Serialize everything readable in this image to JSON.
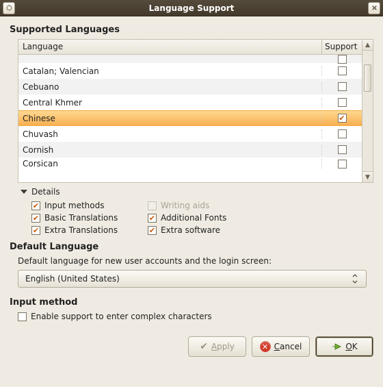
{
  "window": {
    "title": "Language Support"
  },
  "sections": {
    "supported": "Supported Languages",
    "default": "Default Language",
    "input": "Input method"
  },
  "table": {
    "col_language": "Language",
    "col_support": "Support",
    "rows": [
      {
        "name": "",
        "supported": false,
        "partial_top": true
      },
      {
        "name": "Catalan; Valencian",
        "supported": false
      },
      {
        "name": "Cebuano",
        "supported": false
      },
      {
        "name": "Central Khmer",
        "supported": false
      },
      {
        "name": "Chinese",
        "supported": true,
        "selected": true
      },
      {
        "name": "Chuvash",
        "supported": false
      },
      {
        "name": "Cornish",
        "supported": false
      },
      {
        "name": "Corsican",
        "supported": false,
        "partial_bottom": true
      }
    ]
  },
  "details": {
    "label": "Details",
    "components": {
      "input_methods": {
        "label": "Input methods",
        "checked": true,
        "disabled": false
      },
      "writing_aids": {
        "label": "Writing aids",
        "checked": false,
        "disabled": true
      },
      "basic_translations": {
        "label": "Basic Translations",
        "checked": true,
        "disabled": false
      },
      "additional_fonts": {
        "label": "Additional Fonts",
        "checked": true,
        "disabled": false
      },
      "extra_translations": {
        "label": "Extra Translations",
        "checked": true,
        "disabled": false
      },
      "extra_software": {
        "label": "Extra software",
        "checked": true,
        "disabled": false
      }
    }
  },
  "default_language": {
    "description": "Default language for new user accounts and the login screen:",
    "value": "English (United States)"
  },
  "input_method": {
    "enable_complex": {
      "label": "Enable support to enter complex characters",
      "checked": false
    }
  },
  "buttons": {
    "apply": {
      "label": "Apply",
      "mnemonic": "A"
    },
    "cancel": {
      "label": "Cancel",
      "mnemonic": "C"
    },
    "ok": {
      "label": "OK",
      "mnemonic": "O"
    }
  }
}
